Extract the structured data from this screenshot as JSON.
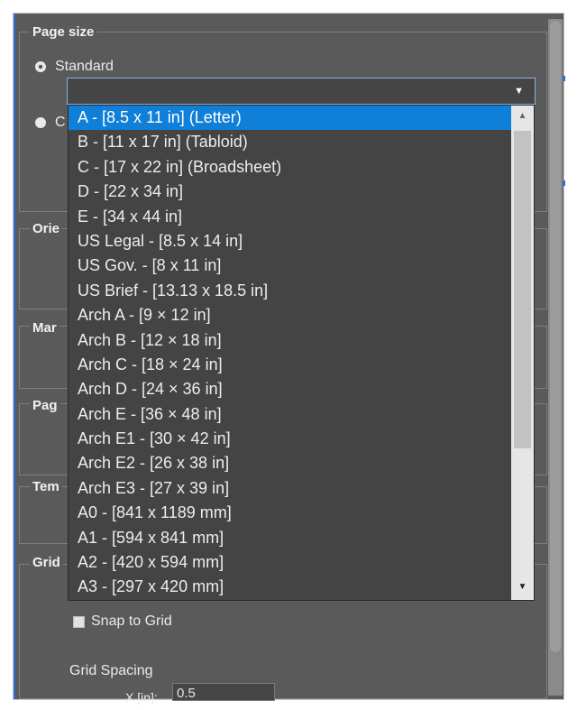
{
  "page_size": {
    "legend": "Page size",
    "standard_label": "Standard",
    "custom_label_partial": "C",
    "selected_value": ""
  },
  "sections": {
    "orientation_partial": "Orie",
    "margins_partial": "Mar",
    "page_partial": "Pag",
    "template_partial": "Tem",
    "grid_partial": "Grid"
  },
  "grid": {
    "snap_label": "Snap to Grid",
    "spacing_label": "Grid Spacing",
    "x_label_partial": "X [in]:",
    "x_value": "0.5"
  },
  "dropdown": {
    "selected_index": 0,
    "items": [
      "A - [8.5 x 11 in] (Letter)",
      "B - [11 x 17 in] (Tabloid)",
      "C - [17 x 22 in] (Broadsheet)",
      "D - [22 x 34 in]",
      "E - [34 x 44 in]",
      "US Legal - [8.5 x 14 in]",
      "US Gov. - [8 x 11 in]",
      "US Brief - [13.13 x 18.5 in]",
      "Arch A - [9 × 12 in]",
      "Arch B - [12 × 18 in]",
      "Arch C - [18 × 24 in]",
      "Arch D - [24 × 36 in]",
      "Arch E - [36 × 48 in]",
      "Arch E1 - [30 × 42 in]",
      "Arch E2 - [26 x 38 in]",
      "Arch E3 - [27 x 39 in]",
      "A0 - [841 x 1189 mm]",
      "A1 - [594 x 841 mm]",
      "A2 - [420 x 594 mm]",
      "A3 - [297 x 420 mm]"
    ]
  },
  "icons": {
    "select_arrow": "▼",
    "scroll_up": "▲",
    "scroll_down": "▼"
  }
}
